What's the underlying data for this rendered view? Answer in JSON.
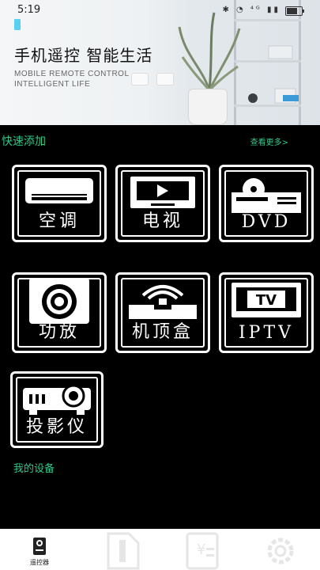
{
  "status_bar": {
    "time": "5:19",
    "icons": "✱ ◔ ⁴ᴳ ▮▮",
    "battery_level": 0.8
  },
  "hero": {
    "title": "手机遥控 智能生活",
    "subtitle_line1": "MOBILE REMOTE CONTROL",
    "subtitle_line2": "INTELLIGENT LIFE"
  },
  "quick_add": {
    "title": "快速添加",
    "more_label": "查看更多>",
    "devices": [
      {
        "label": "空调",
        "icon": "air-conditioner-icon"
      },
      {
        "label": "电视",
        "icon": "tv-icon"
      },
      {
        "label": "DVD",
        "icon": "dvd-player-icon"
      },
      {
        "label": "功放",
        "icon": "amplifier-speaker-icon"
      },
      {
        "label": "机顶盒",
        "icon": "set-top-box-icon"
      },
      {
        "label": "IPTV",
        "icon": "iptv-icon"
      },
      {
        "label": "投影仪",
        "icon": "projector-icon"
      }
    ],
    "iptv_screen_text": "TV"
  },
  "my_devices": {
    "title": "我的设备"
  },
  "tabbar": {
    "tabs": [
      {
        "label": "遥控器",
        "icon": "remote-icon",
        "active": true
      },
      {
        "label": "",
        "icon": "document-icon",
        "active": false
      },
      {
        "label": "",
        "icon": "calculator-icon",
        "active": false
      },
      {
        "label": "",
        "icon": "gear-icon",
        "active": false
      }
    ]
  },
  "colors": {
    "accent": "#2ec98a",
    "background": "#000000",
    "tile_border": "#ffffff"
  }
}
